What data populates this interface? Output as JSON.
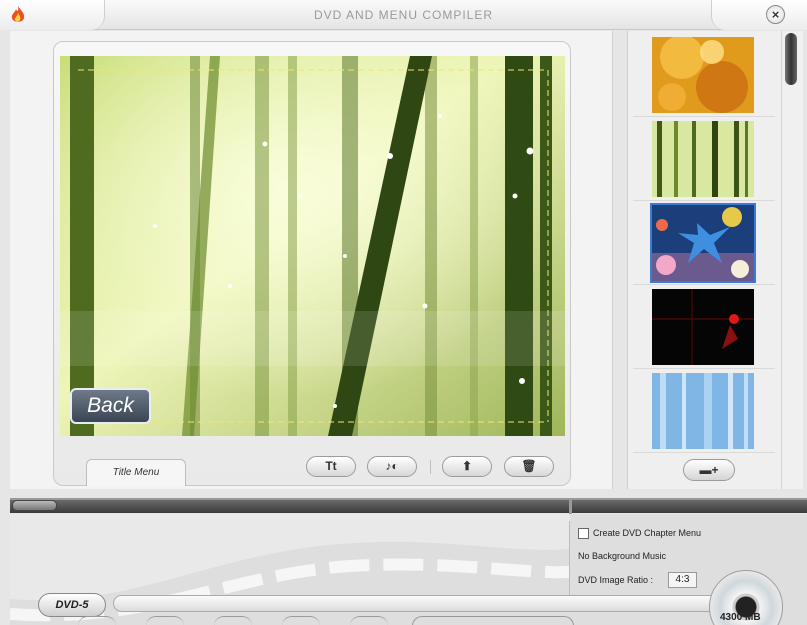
{
  "window": {
    "title": "DVD AND MENU COMPILER"
  },
  "preview": {
    "back_label": "Back"
  },
  "toolbar": {
    "tab_title_menu": "Title Menu",
    "text_button": "Tt",
    "music_button": "♪◐",
    "up_button": "⬆",
    "delete_button": "🗑"
  },
  "backgrounds": {
    "add_label": "▬+"
  },
  "options": {
    "create_chapter_label": "Create DVD Chapter Menu",
    "background_music": "No Background Music",
    "image_ratio_label": "DVD Image Ratio :",
    "image_ratio_value": "4:3"
  },
  "capacity": {
    "disc_type": "DVD-5",
    "size_label": "4300 MB"
  }
}
